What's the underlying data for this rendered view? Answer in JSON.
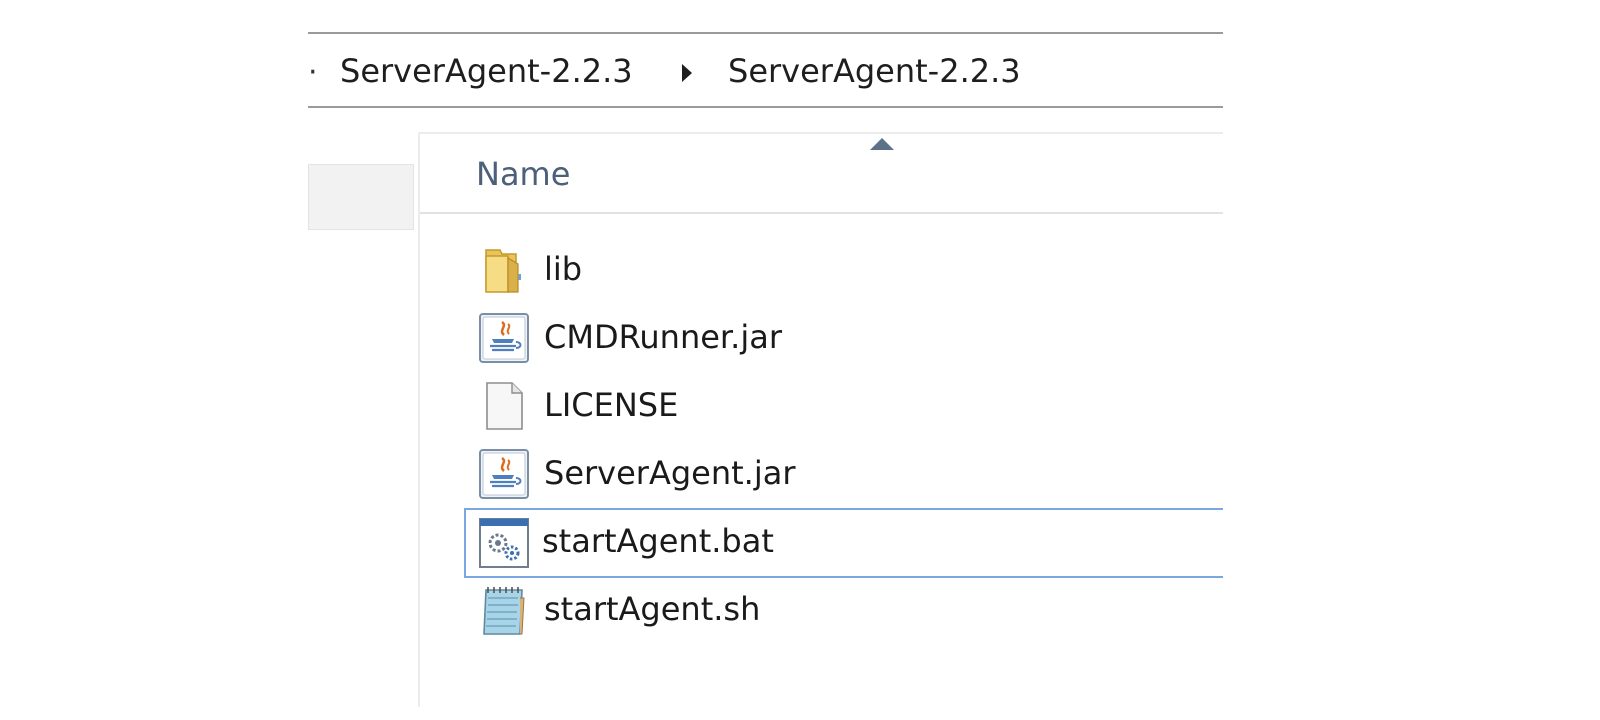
{
  "address_bar": {
    "lead_separator": "·",
    "breadcrumbs": [
      "ServerAgent-2.2.3",
      "ServerAgent-2.2.3"
    ]
  },
  "file_list": {
    "column_header": "Name",
    "sort_direction": "ascending",
    "selection_color": "#7aa7e0",
    "items": [
      {
        "name": "lib",
        "icon": "folder-icon"
      },
      {
        "name": "CMDRunner.jar",
        "icon": "java-jar-icon"
      },
      {
        "name": "LICENSE",
        "icon": "blank-file-icon"
      },
      {
        "name": "ServerAgent.jar",
        "icon": "java-jar-icon"
      },
      {
        "name": "startAgent.bat",
        "icon": "batch-file-icon",
        "selected": true
      },
      {
        "name": "startAgent.sh",
        "icon": "text-file-icon"
      }
    ]
  }
}
